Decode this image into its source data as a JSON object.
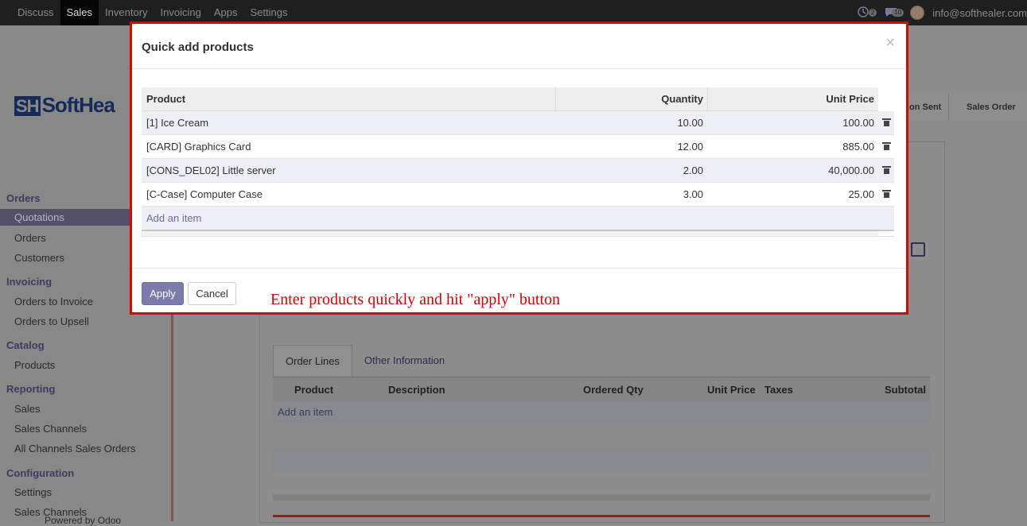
{
  "navbar": {
    "menu": [
      "Discuss",
      "Sales",
      "Inventory",
      "Invoicing",
      "Apps",
      "Settings"
    ],
    "active_index": 1,
    "activity_badge": "2",
    "messages_badge": "10",
    "user_email": "info@softhealer.com"
  },
  "logo_text": "SoftHea",
  "sidebar": {
    "orders_section": "Orders",
    "quotations": "Quotations",
    "orders": "Orders",
    "customers": "Customers",
    "invoicing_section": "Invoicing",
    "orders_to_invoice": "Orders to Invoice",
    "orders_to_upsell": "Orders to Upsell",
    "catalog_section": "Catalog",
    "products": "Products",
    "reporting_section": "Reporting",
    "sales": "Sales",
    "sales_channels": "Sales Channels",
    "all_channels_sales_orders": "All Channels Sales Orders",
    "configuration_section": "Configuration",
    "settings": "Settings",
    "sales_channels_2": "Sales Channels",
    "powered_by": "Powered by Odoo"
  },
  "status_bar": {
    "sent": "on Sent",
    "sales_order": "Sales Order"
  },
  "form": {
    "tab_order_lines": "Order Lines",
    "tab_other_information": "Other Information",
    "columns": {
      "product": "Product",
      "description": "Description",
      "ordered_qty": "Ordered Qty",
      "unit_price": "Unit Price",
      "taxes": "Taxes",
      "subtotal": "Subtotal"
    },
    "add_item": "Add an item"
  },
  "modal": {
    "title": "Quick add products",
    "close_symbol": "×",
    "columns": {
      "product": "Product",
      "quantity": "Quantity",
      "unit_price": "Unit Price"
    },
    "rows": [
      {
        "product": "[1] Ice Cream",
        "quantity": "10.00",
        "unit_price": "100.00"
      },
      {
        "product": "[CARD] Graphics Card",
        "quantity": "12.00",
        "unit_price": "885.00"
      },
      {
        "product": "[CONS_DEL02] Little server",
        "quantity": "2.00",
        "unit_price": "40,000.00"
      },
      {
        "product": "[C-Case] Computer Case",
        "quantity": "3.00",
        "unit_price": "25.00"
      }
    ],
    "add_item": "Add an item",
    "apply_label": "Apply",
    "cancel_label": "Cancel",
    "annotation": "Enter products quickly and hit \"apply\" button"
  },
  "colors": {
    "annotation_red": "#e20000",
    "primary": "#7c7bad"
  }
}
